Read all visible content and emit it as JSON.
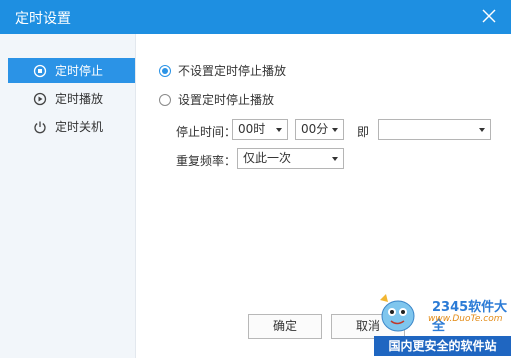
{
  "window": {
    "title": "定时设置"
  },
  "sidebar": {
    "items": [
      {
        "label": "定时停止",
        "icon": "timer-stop-icon",
        "active": true
      },
      {
        "label": "定时播放",
        "icon": "timer-play-icon",
        "active": false
      },
      {
        "label": "定时关机",
        "icon": "power-icon",
        "active": false
      }
    ]
  },
  "main": {
    "option_no_timer": "不设置定时停止播放",
    "option_set_timer": "设置定时停止播放",
    "stop_time_label": "停止时间：",
    "hour_value": "00时",
    "minute_value": "00分",
    "date_label": "即",
    "date_value": "",
    "repeat_label": "重复频率：",
    "repeat_value": "仅此一次"
  },
  "buttons": {
    "ok": "确定",
    "cancel": "取消"
  },
  "watermark": {
    "brand": "2345软件大全",
    "url": "www.DuoTe.com",
    "bottom_text": "国内更安全的软件站"
  },
  "colors": {
    "accent": "#2b93e6",
    "titlebar": "#1e8fe1"
  }
}
